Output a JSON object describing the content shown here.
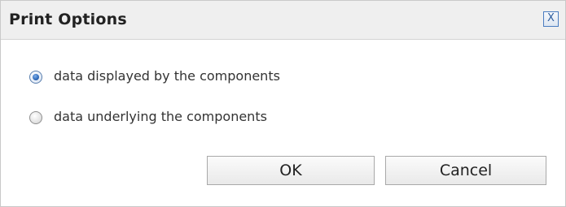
{
  "dialog": {
    "title": "Print Options",
    "close_label": "X"
  },
  "options": [
    {
      "label": "data displayed by the components",
      "selected": true
    },
    {
      "label": "data underlying the components",
      "selected": false
    }
  ],
  "buttons": {
    "ok_label": "OK",
    "cancel_label": "Cancel"
  },
  "colors": {
    "titlebar_bg": "#efefef",
    "radio_accent": "#2e69b8",
    "close_border": "#4a7cc0"
  }
}
